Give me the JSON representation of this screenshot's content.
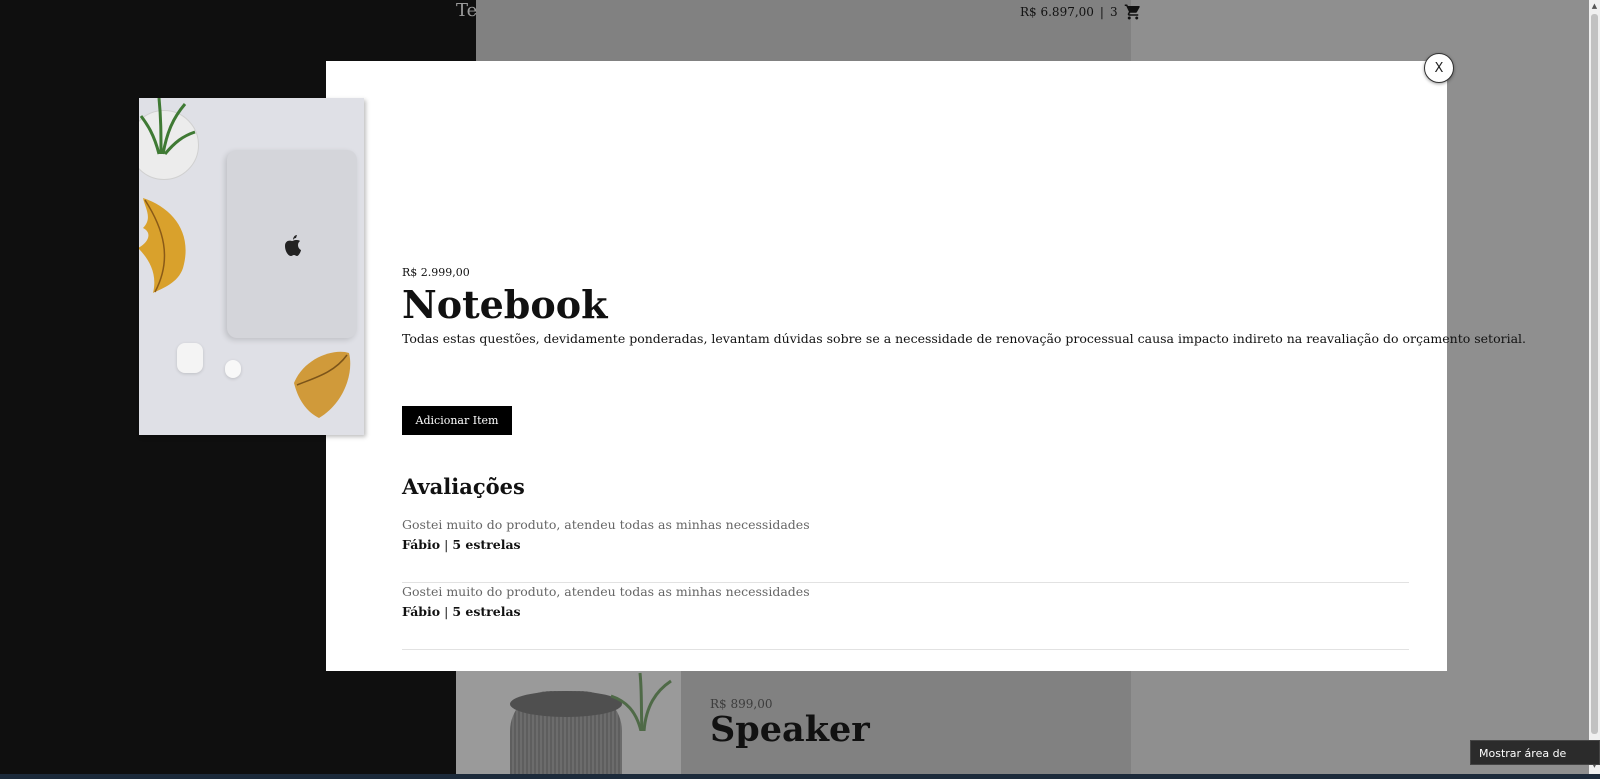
{
  "header": {
    "logo_text": "Te",
    "cart_total": "R$ 6.897,00",
    "cart_count": "3"
  },
  "background_card": {
    "price": "R$ 899,00",
    "name": "Speaker"
  },
  "modal": {
    "close_label": "X",
    "product": {
      "price": "R$ 2.999,00",
      "name": "Notebook",
      "description": "Todas estas questões, devidamente ponderadas, levantam dúvidas sobre se a necessidade de renovação processual causa impacto indireto na reavaliação do orçamento setorial.",
      "add_button_label": "Adicionar Item"
    },
    "reviews_title": "Avaliações",
    "reviews": [
      {
        "text": "Gostei muito do produto, atendeu todas as minhas necessidades",
        "author": "Fábio",
        "rating": "5 estrelas"
      },
      {
        "text": "Gostei muito do produto, atendeu todas as minhas necessidades",
        "author": "Fábio",
        "rating": "5 estrelas"
      }
    ]
  },
  "system": {
    "tooltip": "Mostrar área de trabalho"
  }
}
